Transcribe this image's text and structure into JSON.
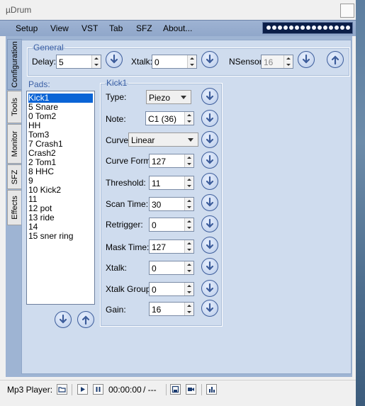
{
  "app": {
    "title": "µDrum"
  },
  "menu": [
    "Setup",
    "View",
    "VST",
    "Tab",
    "SFZ",
    "About..."
  ],
  "side_tabs": [
    "Configuration",
    "Tools",
    "Monitor",
    "SFZ",
    "Effects"
  ],
  "general": {
    "legend": "General",
    "delay": {
      "label": "Delay:",
      "value": "5"
    },
    "xtalk": {
      "label": "Xtalk:",
      "value": "0"
    },
    "nsensor": {
      "label": "NSensor:",
      "value": "16"
    }
  },
  "pads": {
    "legend": "Pads:",
    "items": [
      "Kick1",
      "5 Snare",
      "0 Tom2",
      "HH",
      "Tom3",
      "7 Crash1",
      "Crash2",
      "2 Tom1",
      "8 HHC",
      "9",
      "10 Kick2",
      "11",
      "12 pot",
      "13 ride",
      "14",
      "15 sner ring"
    ],
    "selected": "Kick1"
  },
  "kick": {
    "legend": "Kick1",
    "type": {
      "label": "Type:",
      "value": "Piezo"
    },
    "note": {
      "label": "Note:",
      "value": "C1 (36)"
    },
    "curve": {
      "label": "Curve:",
      "value": "Linear"
    },
    "curve_form": {
      "label": "Curve Form:",
      "value": "127"
    },
    "threshold": {
      "label": "Threshold:",
      "value": "11"
    },
    "scan_time": {
      "label": "Scan Time:",
      "value": "30"
    },
    "retrigger": {
      "label": "Retrigger:",
      "value": "0"
    },
    "mask_time": {
      "label": "Mask Time:",
      "value": "127"
    },
    "xtalk": {
      "label": "Xtalk:",
      "value": "0"
    },
    "xtalk_group": {
      "label": "Xtalk Group:",
      "value": "0"
    },
    "gain": {
      "label": "Gain:",
      "value": "16"
    }
  },
  "player": {
    "label": "Mp3 Player:",
    "time": "00:00:00",
    "total": "/ ---"
  },
  "icons": {
    "download": "circle-arrow-down-icon",
    "upload": "circle-arrow-up-icon"
  },
  "colors": {
    "menubar": "#9eb3d3",
    "panel": "#cfdcee",
    "selection": "#0a64d6",
    "meter": "#0b1e48"
  }
}
